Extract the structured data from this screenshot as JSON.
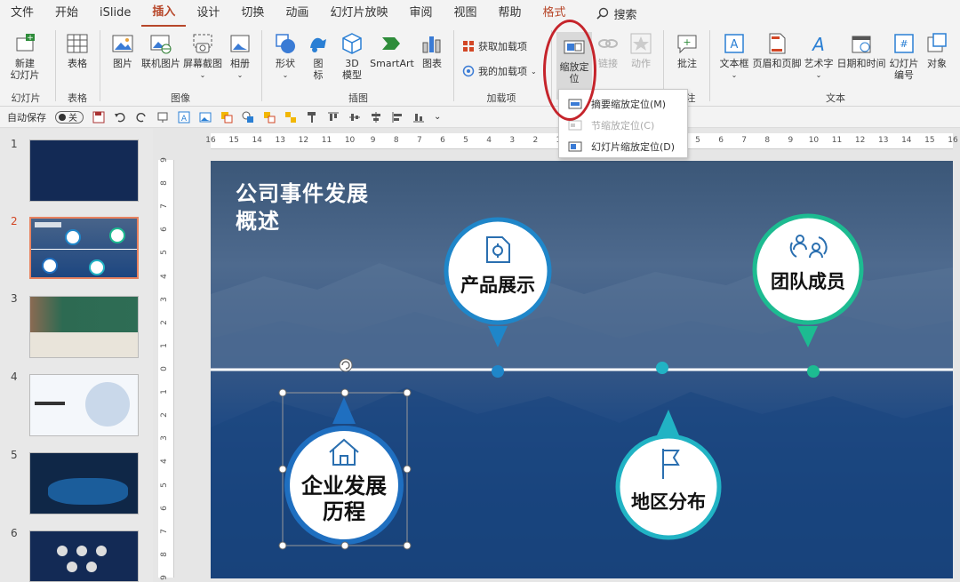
{
  "menu": {
    "items": [
      "文件",
      "开始",
      "iSlide",
      "插入",
      "设计",
      "切换",
      "动画",
      "幻灯片放映",
      "审阅",
      "视图",
      "帮助",
      "格式"
    ],
    "active": "插入",
    "search_label": "搜索"
  },
  "ribbon": {
    "new_slide": "新建\n幻灯片",
    "table": "表格",
    "picture": "图片",
    "online_picture": "联机图片",
    "screenshot": "屏幕截图",
    "album": "相册",
    "shape": "形状",
    "icon": "图\n标",
    "model3d": "3D\n模型",
    "smartart": "SmartArt",
    "chart": "图表",
    "get_addins": "获取加载项",
    "my_addins": "我的加载项",
    "zoom": "缩放定\n位",
    "link": "链接",
    "action": "动作",
    "comment": "批注",
    "textbox": "文本框",
    "header_footer": "页眉和页脚",
    "wordart": "艺术字",
    "datetime": "日期和时间",
    "slide_number": "幻灯片\n编号",
    "object": "对象",
    "groups": {
      "slides": "幻灯片",
      "table": "表格",
      "images": "图像",
      "illustrations": "插图",
      "addins": "加载项",
      "comments": "注",
      "text": "文本"
    }
  },
  "qat": {
    "autosave_label": "自动保存",
    "autosave_state": "关"
  },
  "dropdown": {
    "items": [
      {
        "label": "摘要缩放定位(M)",
        "enabled": true
      },
      {
        "label": "节缩放定位(C)",
        "enabled": false
      },
      {
        "label": "幻灯片缩放定位(D)",
        "enabled": true
      }
    ]
  },
  "thumbnails": [
    {
      "num": "1",
      "selected": false
    },
    {
      "num": "2",
      "selected": true
    },
    {
      "num": "3",
      "selected": false
    },
    {
      "num": "4",
      "selected": false
    },
    {
      "num": "5",
      "selected": false
    },
    {
      "num": "6",
      "selected": false
    }
  ],
  "ruler_h": [
    "16",
    "15",
    "14",
    "13",
    "12",
    "11",
    "10",
    "9",
    "8",
    "7",
    "6",
    "5",
    "4",
    "3",
    "2",
    "1",
    "0",
    "1",
    "2",
    "3",
    "4",
    "5",
    "6",
    "7",
    "8",
    "9",
    "10",
    "11",
    "12",
    "13",
    "14",
    "15",
    "16"
  ],
  "ruler_v": [
    "9",
    "8",
    "7",
    "6",
    "5",
    "4",
    "3",
    "2",
    "1",
    "0",
    "1",
    "2",
    "3",
    "4",
    "5",
    "6",
    "7",
    "8",
    "9"
  ],
  "slide": {
    "title_line1": "公司事件发展",
    "title_line2": "概述",
    "nodes": [
      {
        "label": "产品展示",
        "color": "#1f86c9"
      },
      {
        "label": "团队成员",
        "color": "#1dbb91"
      },
      {
        "label": "企业发展\n历程",
        "color": "#1f6fc0"
      },
      {
        "label": "地区分布",
        "color": "#21b3c4"
      }
    ]
  },
  "colors": {
    "accent": "#b7472a",
    "annotation": "#c5242b"
  }
}
